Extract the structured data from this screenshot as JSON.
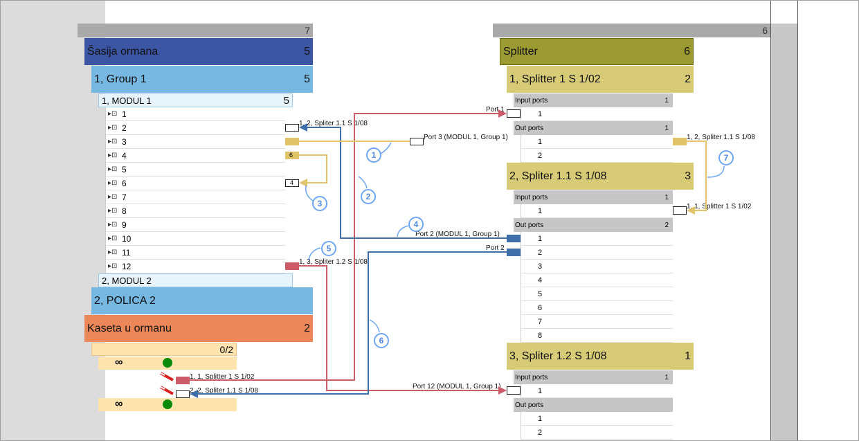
{
  "left": {
    "header_count": "7",
    "sasija": {
      "label": "Šasija ormana",
      "count": "5"
    },
    "group1": {
      "label": "1, Group 1",
      "count": "5"
    },
    "modul1": {
      "label": "1, MODUL 1",
      "count": "5"
    },
    "ports": [
      "1",
      "2",
      "3",
      "4",
      "5",
      "6",
      "7",
      "8",
      "9",
      "10",
      "11",
      "12"
    ],
    "port_icon": "port-icon",
    "modul2": {
      "label": "2, MODUL 2"
    },
    "polica": {
      "label": "2, POLICA 2"
    },
    "kaseta": {
      "label": "Kaseta u ormanu",
      "count": "2"
    },
    "kaseta_count": "0/2",
    "infinity": "∞",
    "conn_labels": {
      "p2": "1, 2, Spliter 1.1 S 1/08",
      "p4": "6",
      "p6": "4",
      "p12": "1, 3, Spliter 1.2 S 1/08",
      "k1": "1, 1, Splitter 1 S 1/02",
      "k2": "2, 2, Spliter 1.1 S 1/08"
    }
  },
  "right": {
    "header_count": "6",
    "splitter": {
      "label": "Splitter",
      "count": "6"
    },
    "s1": {
      "label": "1, Splitter 1 S 1/02",
      "count": "2"
    },
    "s1_in": {
      "label": "Input ports",
      "count": "1"
    },
    "s1_in_rows": [
      "1"
    ],
    "s1_out": {
      "label": "Out ports",
      "count": "1"
    },
    "s1_out_rows": [
      "1",
      "2"
    ],
    "s2": {
      "label": "2, Spliter 1.1 S 1/08",
      "count": "3"
    },
    "s2_in": {
      "label": "Input ports",
      "count": "1"
    },
    "s2_in_rows": [
      "1"
    ],
    "s2_out": {
      "label": "Out ports",
      "count": "2"
    },
    "s2_out_rows": [
      "1",
      "2",
      "3",
      "4",
      "5",
      "6",
      "7",
      "8"
    ],
    "s3": {
      "label": "3, Spliter 1.2 S 1/08",
      "count": "1"
    },
    "s3_in": {
      "label": "Input ports",
      "count": "1"
    },
    "s3_in_rows": [
      "1"
    ],
    "s3_out": {
      "label": "Out ports"
    },
    "s3_out_rows": [
      "1",
      "2"
    ],
    "conn_labels": {
      "port1": "Port 1",
      "out1": "1, 2, Spliter 1.1 S 1/08",
      "s2in": "1, 1, Splitter 1 S 1/02",
      "port2": "Port 2",
      "port2m": "Port 2 (MODUL 1, Group 1)",
      "port12m": "Port 12 (MODUL 1, Group 1)"
    }
  },
  "middle": {
    "port3": "Port 3 (MODUL 1, Group 1)"
  },
  "callouts": [
    "1",
    "2",
    "3",
    "4",
    "5",
    "6",
    "7"
  ],
  "colors": {
    "red": "#cd5c6a",
    "yellow": "#e1c46a",
    "blue": "#3e6fa8",
    "callout": "#6ea6f2",
    "sasija": "#3c56a4",
    "group": "#77b8e3",
    "kaseta": "#ec875a",
    "splitter": "#9c9a33",
    "spl_sub": "#d8cb78"
  }
}
